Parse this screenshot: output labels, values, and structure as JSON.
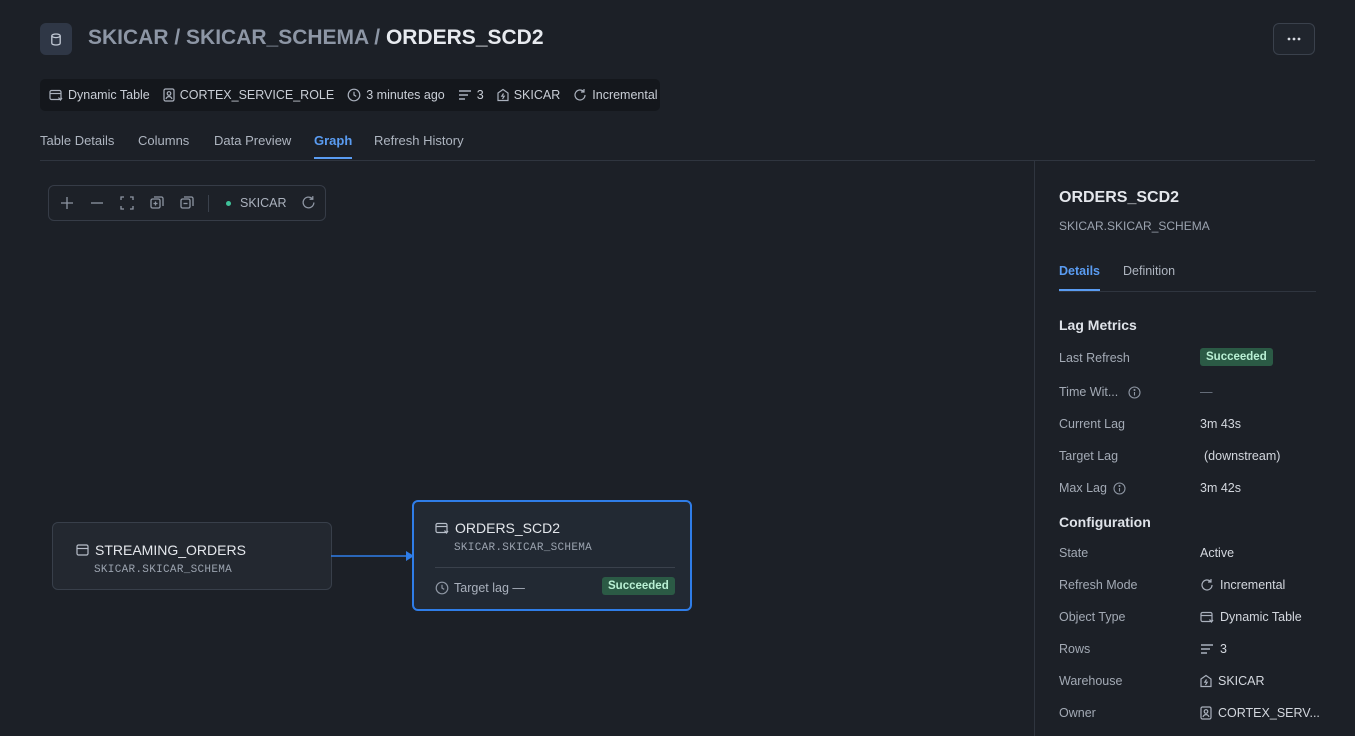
{
  "header": {
    "breadcrumb": {
      "database": "SKICAR",
      "sep1": " / ",
      "schema": "SKICAR_SCHEMA",
      "sep2": " / ",
      "table": "ORDERS_SCD2"
    },
    "more_label": "···"
  },
  "meta": {
    "type": "Dynamic Table",
    "owner": "CORTEX_SERVICE_ROLE",
    "updated": "3 minutes ago",
    "rows": "3",
    "warehouse": "SKICAR",
    "refresh_mode": "Incremental"
  },
  "tabs": [
    {
      "label": "Table Details"
    },
    {
      "label": "Columns"
    },
    {
      "label": "Data Preview"
    },
    {
      "label": "Graph",
      "active": true
    },
    {
      "label": "Refresh History"
    }
  ],
  "graph": {
    "toolbar": {
      "warehouse": "SKICAR",
      "warehouse_status_color": "#3fc29a"
    },
    "nodes": {
      "source": {
        "name": "STREAMING_ORDERS",
        "path": "SKICAR.SKICAR_SCHEMA",
        "icon": "table-icon"
      },
      "target": {
        "name": "ORDERS_SCD2",
        "path": "SKICAR.SKICAR_SCHEMA",
        "icon": "dynamic-table-icon",
        "lag_text": "Target lag —",
        "status": "Succeeded"
      }
    },
    "edge_color": "#2f7de8"
  },
  "panel": {
    "title": "ORDERS_SCD2",
    "subtitle": "SKICAR.SKICAR_SCHEMA",
    "tabs": [
      {
        "label": "Details",
        "active": true
      },
      {
        "label": "Definition"
      }
    ],
    "lag_metrics": {
      "title": "Lag Metrics",
      "last_refresh_label": "Last Refresh",
      "last_refresh_value": "Succeeded",
      "time_within_label": "Time Wit...",
      "time_within_value": "—",
      "current_lag_label": "Current Lag",
      "current_lag_value": "3m 43s",
      "target_lag_label": "Target Lag",
      "target_lag_value": "(downstream)",
      "max_lag_label": "Max Lag",
      "max_lag_value": "3m 42s"
    },
    "configuration": {
      "title": "Configuration",
      "state_label": "State",
      "state_value": "Active",
      "refresh_mode_label": "Refresh Mode",
      "refresh_mode_value": "Incremental",
      "object_type_label": "Object Type",
      "object_type_value": "Dynamic Table",
      "rows_label": "Rows",
      "rows_value": "3",
      "warehouse_label": "Warehouse",
      "warehouse_value": "SKICAR",
      "owner_label": "Owner",
      "owner_value": "CORTEX_SERV..."
    }
  },
  "colors": {
    "accent": "#5a9cf2",
    "success_bg": "#2b5a45",
    "success_text": "#b9f0d4",
    "background": "#1c2027"
  }
}
